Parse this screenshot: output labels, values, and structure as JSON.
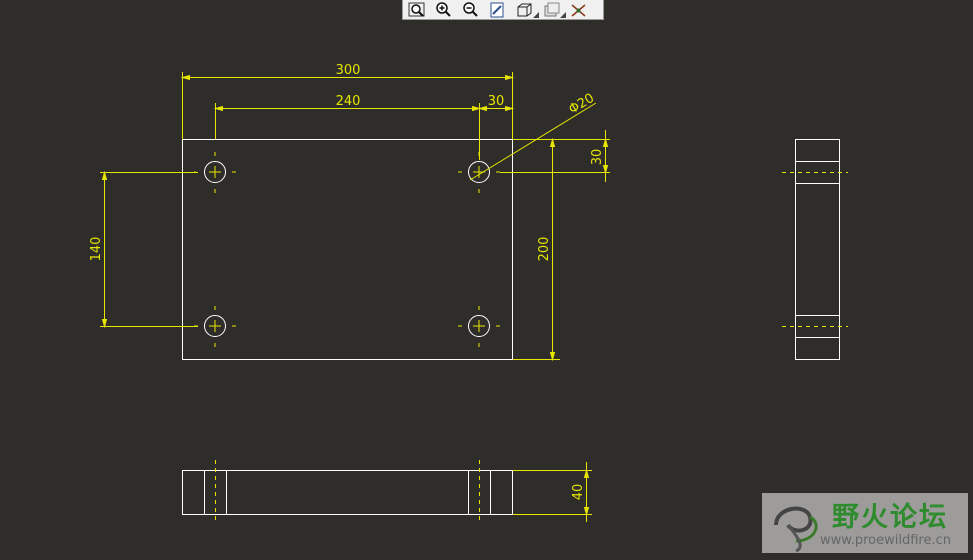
{
  "toolbar": {
    "buttons": [
      {
        "name": "zoom-window-icon"
      },
      {
        "name": "zoom-in-icon"
      },
      {
        "name": "zoom-out-icon"
      },
      {
        "name": "repaint-icon"
      },
      {
        "name": "display-style-icon"
      },
      {
        "name": "saved-views-icon"
      },
      {
        "name": "datum-display-icon"
      }
    ]
  },
  "dimensions": {
    "overall_width": "300",
    "hole_spacing_x": "240",
    "edge_offset_x": "30",
    "hole_diameter": "Φ20",
    "edge_offset_y": "30",
    "overall_height": "200",
    "hole_spacing_y": "140",
    "thickness": "40"
  },
  "watermark": {
    "title": "野火论坛",
    "url": "www.proewildfire.cn"
  },
  "colors": {
    "background": "#2f2d29",
    "geometry": "#ffffff",
    "dimension": "#e6e600",
    "toolbar": "#f0f0f0"
  }
}
